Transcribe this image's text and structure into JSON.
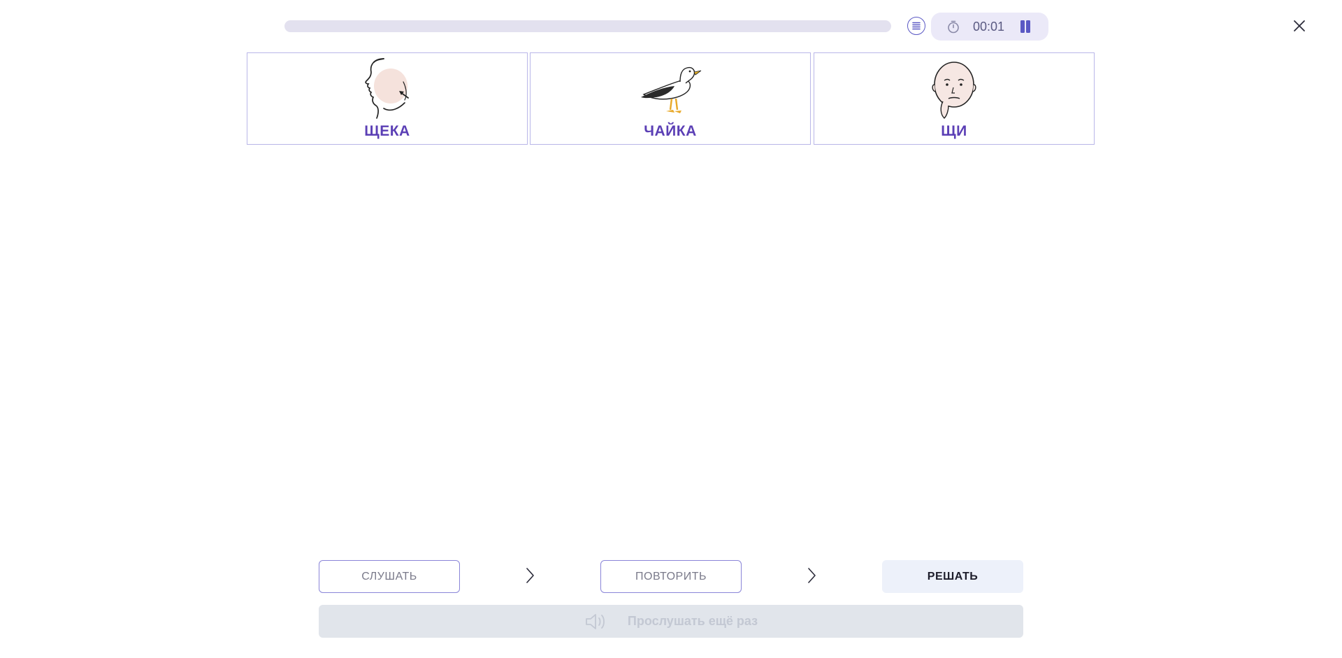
{
  "header": {
    "progress_fraction": 0,
    "timer": {
      "value": "00:01",
      "state": "running"
    },
    "icons": [
      "list-icon",
      "stopwatch-icon",
      "pause-icon",
      "close-icon"
    ]
  },
  "cards": [
    {
      "label": "ЩЕКА",
      "icon": "cheek-picture"
    },
    {
      "label": "ЧАЙКА",
      "icon": "seagull-picture"
    },
    {
      "label": "ЩИ",
      "icon": "face-picture"
    }
  ],
  "steps": {
    "listen_label": "СЛУШАТЬ",
    "repeat_label": "ПОВТОРИТЬ",
    "solve_label": "РЕШАТЬ"
  },
  "listen_again": {
    "label": "Прослушать ещё раз",
    "enabled": false
  },
  "colors": {
    "accent": "#5a58c4",
    "label": "#5b3fb5",
    "card_border": "#b9b6e8",
    "progress_track": "#e3e1ef",
    "timer_bg": "#ebe9f8",
    "solve_bg": "#edf1fa",
    "disabled_bg": "#e1e5eb"
  }
}
